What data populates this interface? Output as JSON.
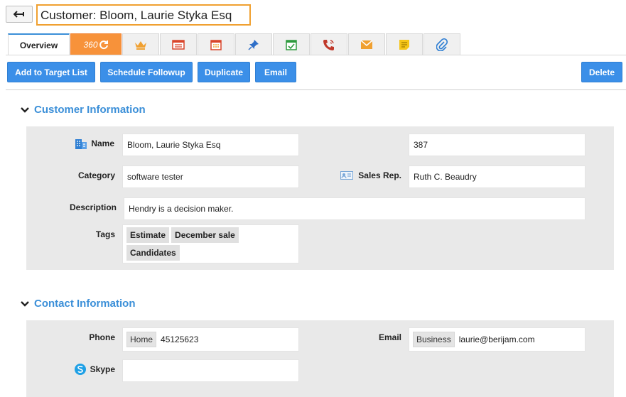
{
  "header": {
    "title": "Customer: Bloom, Laurie Styka Esq"
  },
  "tabs": {
    "overview": "Overview",
    "t360": "360",
    "icon_tabs": [
      "crown-icon",
      "list-card-icon",
      "calendar-icon",
      "pin-icon",
      "calendar-check-icon",
      "phone-call-icon",
      "envelope-icon",
      "sticky-note-icon",
      "paperclip-icon"
    ]
  },
  "actions": {
    "add_to_target": "Add to Target List",
    "schedule_followup": "Schedule Followup",
    "duplicate": "Duplicate",
    "email": "Email",
    "delete": "Delete"
  },
  "customer_info": {
    "title": "Customer Information",
    "name_label": "Name",
    "name_value": "Bloom, Laurie Styka Esq",
    "id_value": "387",
    "category_label": "Category",
    "category_value": "software tester",
    "sales_rep_label": "Sales Rep.",
    "sales_rep_value": "Ruth C. Beaudry",
    "description_label": "Description",
    "description_value": "Hendry is a decision maker.",
    "tags_label": "Tags",
    "tags": [
      "Estimate",
      "December sale",
      "Candidates"
    ]
  },
  "contact_info": {
    "title": "Contact Information",
    "phone_label": "Phone",
    "phone_type": "Home",
    "phone_value": "45125623",
    "email_label": "Email",
    "email_type": "Business",
    "email_value": "laurie@berijam.com",
    "skype_label": "Skype",
    "skype_value": ""
  },
  "colors": {
    "accent": "#3b8fe8",
    "title_border": "#f0a030",
    "tab_360": "#f7923a"
  }
}
